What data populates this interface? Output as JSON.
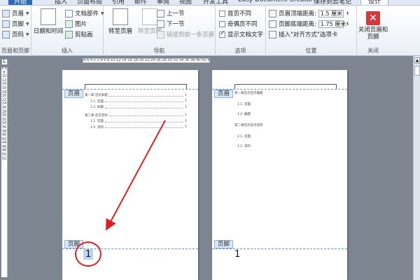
{
  "tabs": [
    "开始",
    "插入",
    "页面布局",
    "引用",
    "邮件",
    "审阅",
    "视图",
    "开发工具",
    "Easy Document Creator",
    "保存到云笔记",
    "设计"
  ],
  "groups": {
    "header_footer": {
      "label": "页眉和页脚",
      "header": "页眉",
      "footer": "页脚",
      "page_number": "页码"
    },
    "insert": {
      "label": "插入",
      "datetime": "日期和时间",
      "doc_parts": "文档部件",
      "picture": "图片",
      "clipart": "剪贴画"
    },
    "navigation": {
      "label": "导航",
      "goto_header": "转至页眉",
      "goto_footer": "转至页脚",
      "prev": "上一节",
      "next": "下一节",
      "link_prev": "链接到前一条页眉"
    },
    "options": {
      "label": "选项",
      "diff_first": "首页不同",
      "diff_odd_even": "奇偶页不同",
      "show_text": "显示文档文字"
    },
    "position": {
      "label": "位置",
      "header_dist_label": "页眉顶端距离:",
      "header_dist_value": "1.5 厘米",
      "footer_dist_label": "页脚底端距离:",
      "footer_dist_value": "1.75 厘米",
      "insert_align": "插入\"对齐方式\"选项卡"
    },
    "close": {
      "label": "关闭",
      "close_btn": "关闭页眉和页脚"
    }
  },
  "ruler": {
    "top": "8 6 4 2   2 4 6 8 10 12 14 16 18 20 22 24 26 28 30 32 34 36 38 40 42 44 46",
    "left": "4 6 8 10 12 14 16 18 20 22 24 26 28 30 32 34 36 38 40 42 44 46 48 50 52",
    "corner": "L"
  },
  "page1": {
    "header_tag": "页眉",
    "footer_tag": "页脚",
    "page_number": "1",
    "toc": [
      {
        "text": "第一章  首页如题",
        "page": "1"
      },
      {
        "text": "1.1.  首面",
        "page": "1"
      },
      {
        "text": "1.2.  如题",
        "page": "1"
      },
      {
        "text": "第二章  首页资料",
        "page": "1"
      },
      {
        "text": "1.1.  首面",
        "page": "1"
      },
      {
        "text": "1.2.  资料",
        "page": "1"
      }
    ]
  },
  "page2": {
    "header_tag": "页眉",
    "footer_tag": "页脚",
    "page_number": "1",
    "lines": [
      "第一章首页首页编题",
      "1.1. 首面",
      "1.2. 编题",
      "第二章首页首页资料",
      "2.1. 首面",
      "2.2. 资料"
    ]
  }
}
